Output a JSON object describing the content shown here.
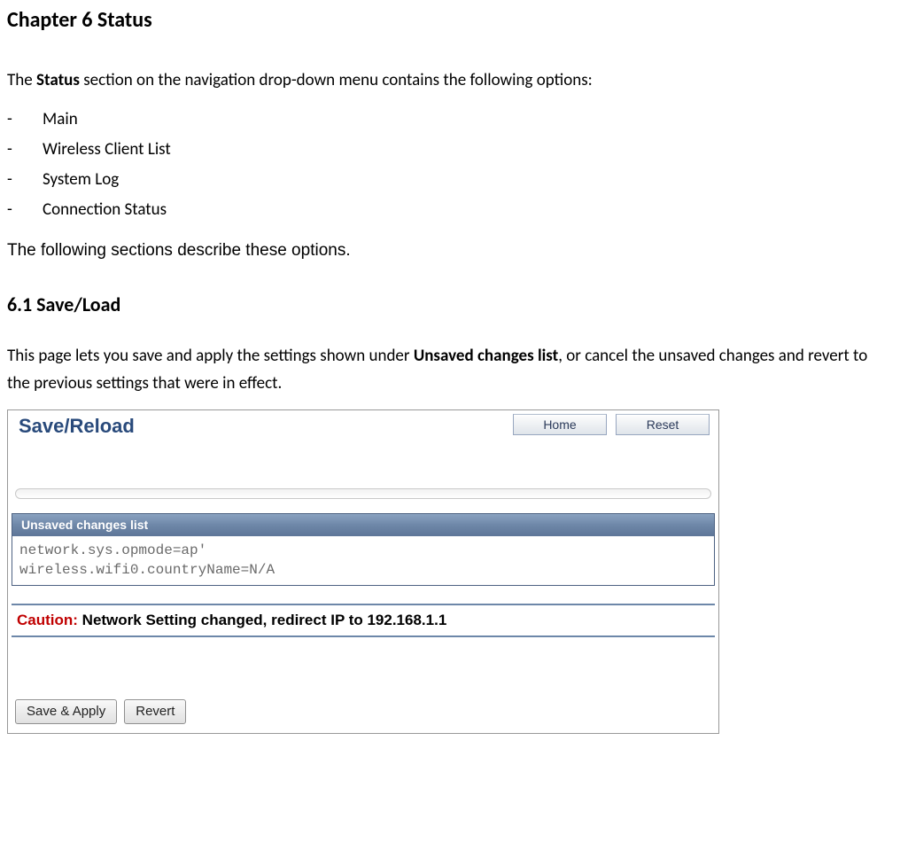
{
  "chapter_title": "Chapter 6 Status",
  "intro": {
    "prefix": "The ",
    "bold": "Status",
    "suffix": " section on the navigation drop-down menu contains the following options:"
  },
  "bullets": [
    "Main",
    "Wireless Client List",
    "System Log",
    "Connection Status"
  ],
  "describe": "The following sections describe these options.",
  "section_heading": "6.1 Save/Load",
  "section_para": {
    "p1": "This page lets you save and apply the settings shown under ",
    "bold": "Unsaved changes list",
    "p2": ", or cancel the unsaved changes and revert to the previous settings that were in effect."
  },
  "screenshot": {
    "title": "Save/Reload",
    "home_btn": "Home",
    "reset_btn": "Reset",
    "changes_header": "Unsaved changes list",
    "changes_body": "network.sys.opmode=ap'\nwireless.wifi0.countryName=N/A",
    "caution_label": "Caution:",
    "caution_text": "  Network Setting changed, redirect IP to 192.168.1.1",
    "save_apply_btn": "Save & Apply",
    "revert_btn": "Revert"
  }
}
